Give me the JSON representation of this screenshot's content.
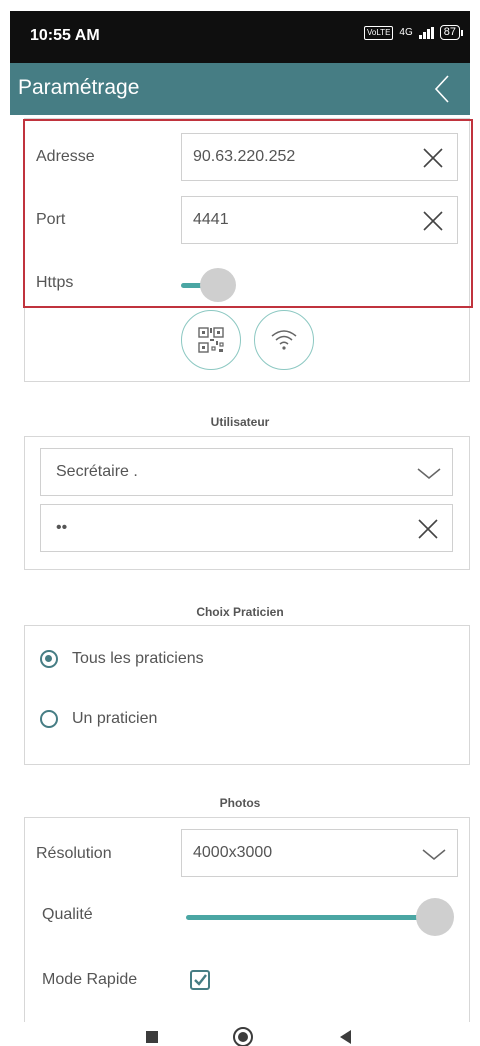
{
  "status_bar": {
    "time": "10:55 AM",
    "network": "4G",
    "volte": "VoLTE",
    "battery": "87"
  },
  "app_bar": {
    "title": "Paramétrage",
    "back_icon": "chevron-left-icon",
    "color": "#467d84"
  },
  "server": {
    "address_label": "Adresse",
    "address_value": "90.63.220.252",
    "port_label": "Port",
    "port_value": "4441",
    "https_label": "Https",
    "https_enabled": true,
    "qr_icon": "qr-code-icon",
    "wifi_icon": "wifi-icon"
  },
  "user": {
    "section_title": "Utilisateur",
    "selected_user": "Secrétaire .",
    "password_value": "••"
  },
  "practitioner": {
    "section_title": "Choix Praticien",
    "options": [
      {
        "label": "Tous les praticiens",
        "checked": true
      },
      {
        "label": "Un praticien",
        "checked": false
      }
    ]
  },
  "photos": {
    "section_title": "Photos",
    "resolution_label": "Résolution",
    "resolution_value": "4000x3000",
    "quality_label": "Qualité",
    "quality_level": 1.0,
    "fast_mode_label": "Mode Rapide",
    "fast_mode_checked": true
  },
  "accent_color": "#4aa6a3",
  "highlight_color": "#c0333d"
}
